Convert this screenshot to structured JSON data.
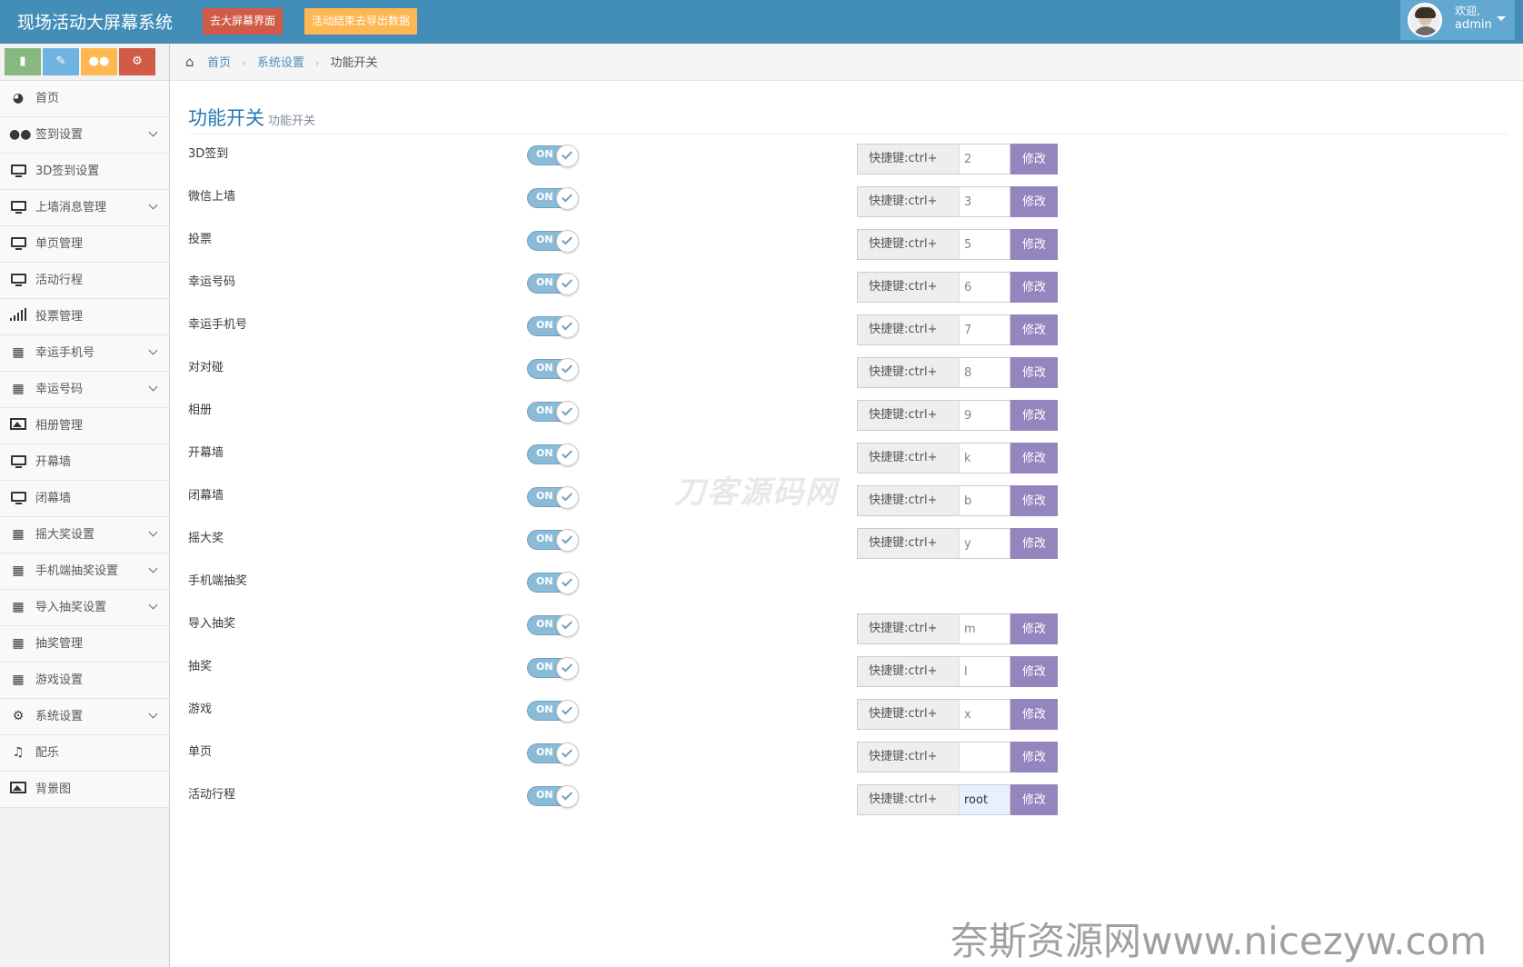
{
  "header": {
    "brand": "现场活动大屏幕系统",
    "btn_screen": "去大屏幕界面",
    "btn_export": "活动结束去导出数据",
    "welcome": "欢迎,",
    "username": "admin"
  },
  "sidebar": {
    "shortcuts": [
      "comment-icon",
      "pencil-icon",
      "users-icon",
      "cogs-icon"
    ],
    "items": [
      {
        "label": "首页",
        "icon": "tachometer-icon",
        "chevron": false
      },
      {
        "label": "签到设置",
        "icon": "users-icon",
        "chevron": true
      },
      {
        "label": "3D签到设置",
        "icon": "desktop-icon",
        "chevron": false
      },
      {
        "label": "上墙消息管理",
        "icon": "desktop-icon",
        "chevron": true
      },
      {
        "label": "单页管理",
        "icon": "desktop-icon",
        "chevron": false
      },
      {
        "label": "活动行程",
        "icon": "desktop-icon",
        "chevron": false
      },
      {
        "label": "投票管理",
        "icon": "signal-icon",
        "chevron": false
      },
      {
        "label": "幸运手机号",
        "icon": "gift-icon",
        "chevron": true
      },
      {
        "label": "幸运号码",
        "icon": "gift-icon",
        "chevron": true
      },
      {
        "label": "相册管理",
        "icon": "picture-icon",
        "chevron": false
      },
      {
        "label": "开幕墙",
        "icon": "desktop-icon",
        "chevron": false
      },
      {
        "label": "闭幕墙",
        "icon": "desktop-icon",
        "chevron": false
      },
      {
        "label": "摇大奖设置",
        "icon": "gift-icon",
        "chevron": true
      },
      {
        "label": "手机端抽奖设置",
        "icon": "gift-icon",
        "chevron": true
      },
      {
        "label": "导入抽奖设置",
        "icon": "gift-icon",
        "chevron": true
      },
      {
        "label": "抽奖管理",
        "icon": "gift-icon",
        "chevron": false
      },
      {
        "label": "游戏设置",
        "icon": "gift-icon",
        "chevron": false
      },
      {
        "label": "系统设置",
        "icon": "cog-icon",
        "chevron": true
      },
      {
        "label": "配乐",
        "icon": "music-icon",
        "chevron": false
      },
      {
        "label": "背景图",
        "icon": "picture-icon",
        "chevron": false
      }
    ]
  },
  "breadcrumb": {
    "home": "首页",
    "parent": "系统设置",
    "current": "功能开关"
  },
  "page": {
    "title": "功能开关",
    "subtitle": "功能开关"
  },
  "switch_on_label": "ON",
  "hotkey_label": "快捷键:ctrl+",
  "modify_label": "修改",
  "features": [
    {
      "label": "3D签到",
      "on": true,
      "hotkey": "2",
      "has_hotkey": true
    },
    {
      "label": "微信上墙",
      "on": true,
      "hotkey": "3",
      "has_hotkey": true
    },
    {
      "label": "投票",
      "on": true,
      "hotkey": "5",
      "has_hotkey": true
    },
    {
      "label": "幸运号码",
      "on": true,
      "hotkey": "6",
      "has_hotkey": true
    },
    {
      "label": "幸运手机号",
      "on": true,
      "hotkey": "7",
      "has_hotkey": true
    },
    {
      "label": "对对碰",
      "on": true,
      "hotkey": "8",
      "has_hotkey": true
    },
    {
      "label": "相册",
      "on": true,
      "hotkey": "9",
      "has_hotkey": true
    },
    {
      "label": "开幕墙",
      "on": true,
      "hotkey": "k",
      "has_hotkey": true
    },
    {
      "label": "闭幕墙",
      "on": true,
      "hotkey": "b",
      "has_hotkey": true
    },
    {
      "label": "摇大奖",
      "on": true,
      "hotkey": "y",
      "has_hotkey": true
    },
    {
      "label": "手机端抽奖",
      "on": true,
      "hotkey": "",
      "has_hotkey": false
    },
    {
      "label": "导入抽奖",
      "on": true,
      "hotkey": "m",
      "has_hotkey": true
    },
    {
      "label": "抽奖",
      "on": true,
      "hotkey": "l",
      "has_hotkey": true
    },
    {
      "label": "游戏",
      "on": true,
      "hotkey": "x",
      "has_hotkey": true
    },
    {
      "label": "单页",
      "on": true,
      "hotkey": "",
      "has_hotkey": true
    },
    {
      "label": "活动行程",
      "on": true,
      "hotkey": "root",
      "has_hotkey": true
    }
  ],
  "watermarks": {
    "center": "刀客源码网",
    "bottom": "奈斯资源网www.nicezyw.com"
  },
  "colors": {
    "navbar": "#438eb9",
    "accent_link": "#4c8fbd",
    "modify_button": "#9585bf",
    "switch_on": "#8bbcd7"
  }
}
